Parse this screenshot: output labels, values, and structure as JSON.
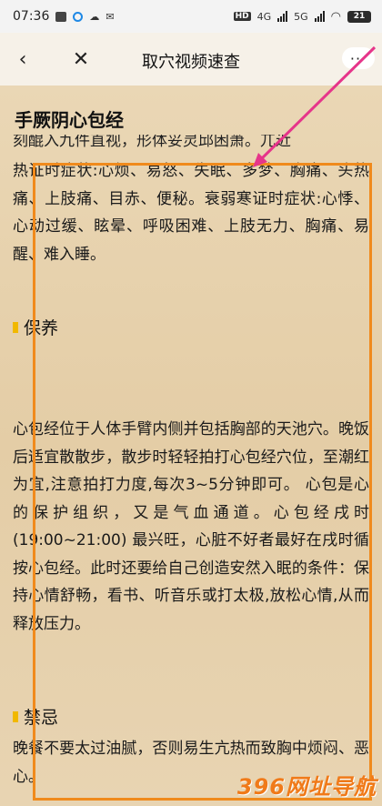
{
  "status_bar": {
    "time": "07:36",
    "hd_label": "HD",
    "net1": "4G",
    "net2": "5G",
    "battery": "21"
  },
  "nav": {
    "title": "取穴视频速查",
    "back_icon": "‹",
    "close_icon": "✕",
    "more_icon": "···"
  },
  "article": {
    "heading": "手厥阴心包经",
    "clipped_top": "刻醌入九件直视，形体妥灵邱困萧。兀近",
    "paragraph1": "热证时症状:心烦、易怒、失眠、多梦、胸痛、头热痛、上肢痛、目赤、便秘。衰弱寒证时症状:心悸、心动过缓、眩晕、呼吸困难、上肢无力、胸痛、易醒、难入睡。",
    "section1_title": "保养",
    "paragraph2": "心包经位于人体手臂内侧并包括胸部的天池穴。晚饭后适宜散散步，散步时轻轻拍打心包经穴位，至潮红为宜,注意拍打力度,每次3~5分钟即可。 心包是心的保护组织，又是气血通道。心包经戌时(19:00~21:00) 最兴旺，心脏不好者最好在戌时循按心包经。此时还要给自己创造安然入眠的条件：保持心情舒畅，看书、听音乐或打太极,放松心情,从而释放压力。",
    "section2_title": "禁忌",
    "paragraph3": "晚餐不要太过油腻，否则易生亢热而致胸中烦闷、恶心。"
  },
  "watermark": "396网址导航",
  "colors": {
    "highlight": "#f08a1c",
    "arrow": "#e6358a",
    "marker": "#f1b800"
  }
}
